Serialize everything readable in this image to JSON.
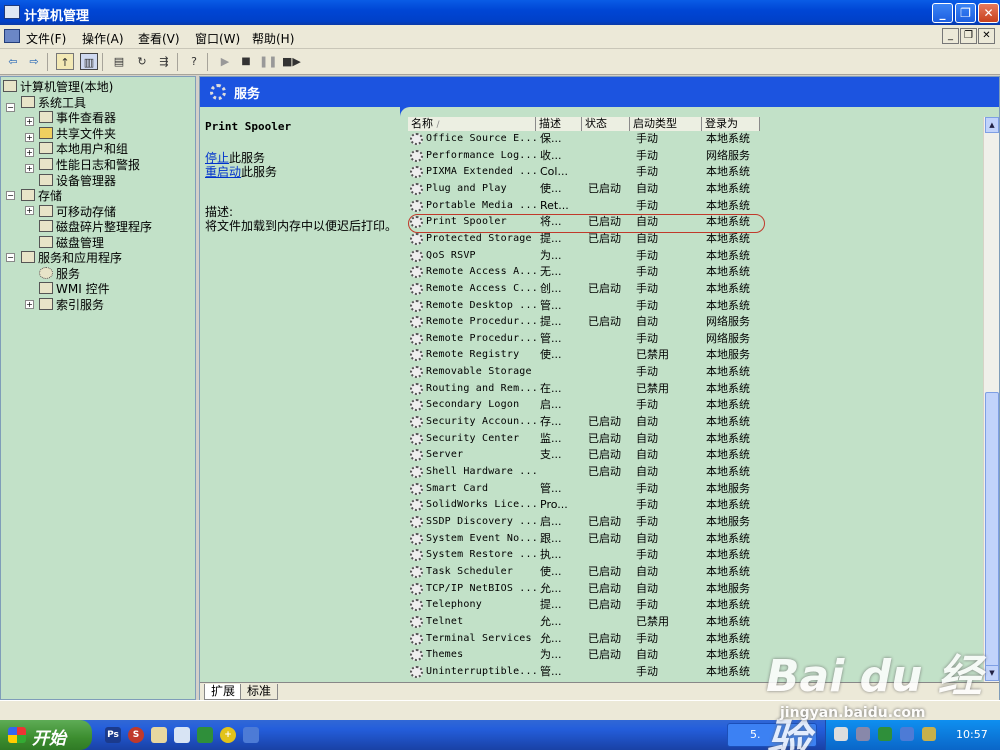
{
  "window": {
    "title": "计算机管理"
  },
  "menu": [
    "文件(F)",
    "操作(A)",
    "查看(V)",
    "窗口(W)",
    "帮助(H)"
  ],
  "tree": {
    "root": "计算机管理(本地)",
    "system_tools": "系统工具",
    "event_viewer": "事件查看器",
    "shared_folders": "共享文件夹",
    "local_users": "本地用户和组",
    "perf_logs": "性能日志和警报",
    "device_manager": "设备管理器",
    "storage": "存储",
    "removable_storage": "可移动存储",
    "defrag": "磁盘碎片整理程序",
    "disk_mgmt": "磁盘管理",
    "services_apps": "服务和应用程序",
    "services": "服务",
    "wmi": "WMI 控件",
    "indexing": "索引服务"
  },
  "header": {
    "title": "服务"
  },
  "desc": {
    "service_name": "Print Spooler",
    "stop_link": "停止",
    "stop_suffix": "此服务",
    "restart_link": "重启动",
    "restart_suffix": "此服务",
    "label": "描述:",
    "text": "将文件加载到内存中以便迟后打印。"
  },
  "columns": [
    "名称",
    "描述",
    "状态",
    "启动类型",
    "登录为"
  ],
  "rows": [
    [
      "Office Source E...",
      "保...",
      "",
      "手动",
      "本地系统"
    ],
    [
      "Performance Log...",
      "收...",
      "",
      "手动",
      "网络服务"
    ],
    [
      "PIXMA Extended ...",
      "Col...",
      "",
      "手动",
      "本地系统"
    ],
    [
      "Plug and Play",
      "使...",
      "已启动",
      "自动",
      "本地系统"
    ],
    [
      "Portable Media ...",
      "Ret...",
      "",
      "手动",
      "本地系统"
    ],
    [
      "Print Spooler",
      "将...",
      "已启动",
      "自动",
      "本地系统"
    ],
    [
      "Protected Storage",
      "提...",
      "已启动",
      "自动",
      "本地系统"
    ],
    [
      "QoS RSVP",
      "为...",
      "",
      "手动",
      "本地系统"
    ],
    [
      "Remote Access A...",
      "无...",
      "",
      "手动",
      "本地系统"
    ],
    [
      "Remote Access C...",
      "创...",
      "已启动",
      "手动",
      "本地系统"
    ],
    [
      "Remote Desktop ...",
      "管...",
      "",
      "手动",
      "本地系统"
    ],
    [
      "Remote Procedur...",
      "提...",
      "已启动",
      "自动",
      "网络服务"
    ],
    [
      "Remote Procedur...",
      "管...",
      "",
      "手动",
      "网络服务"
    ],
    [
      "Remote Registry",
      "使...",
      "",
      "已禁用",
      "本地服务"
    ],
    [
      "Removable Storage",
      "",
      "",
      "手动",
      "本地系统"
    ],
    [
      "Routing and Rem...",
      "在...",
      "",
      "已禁用",
      "本地系统"
    ],
    [
      "Secondary Logon",
      "启...",
      "",
      "手动",
      "本地系统"
    ],
    [
      "Security Accoun...",
      "存...",
      "已启动",
      "自动",
      "本地系统"
    ],
    [
      "Security Center",
      "监...",
      "已启动",
      "自动",
      "本地系统"
    ],
    [
      "Server",
      "支...",
      "已启动",
      "自动",
      "本地系统"
    ],
    [
      "Shell Hardware ...",
      "",
      "已启动",
      "自动",
      "本地系统"
    ],
    [
      "Smart Card",
      "管...",
      "",
      "手动",
      "本地服务"
    ],
    [
      "SolidWorks Lice...",
      "Pro...",
      "",
      "手动",
      "本地系统"
    ],
    [
      "SSDP Discovery ...",
      "启...",
      "已启动",
      "手动",
      "本地服务"
    ],
    [
      "System Event No...",
      "跟...",
      "已启动",
      "自动",
      "本地系统"
    ],
    [
      "System Restore ...",
      "执...",
      "",
      "手动",
      "本地系统"
    ],
    [
      "Task Scheduler",
      "使...",
      "已启动",
      "自动",
      "本地系统"
    ],
    [
      "TCP/IP NetBIOS ...",
      "允...",
      "已启动",
      "自动",
      "本地服务"
    ],
    [
      "Telephony",
      "提...",
      "已启动",
      "手动",
      "本地系统"
    ],
    [
      "Telnet",
      "允...",
      "",
      "已禁用",
      "本地系统"
    ],
    [
      "Terminal Services",
      "允...",
      "已启动",
      "手动",
      "本地系统"
    ],
    [
      "Themes",
      "为...",
      "已启动",
      "自动",
      "本地系统"
    ],
    [
      "Uninterruptible...",
      "管...",
      "",
      "手动",
      "本地系统"
    ]
  ],
  "tabs": [
    "扩展",
    "标准"
  ],
  "taskbar": {
    "start": "开始",
    "task_item": "5.",
    "clock": "10:57"
  },
  "watermark": {
    "brand": "Bai du 经验",
    "url": "jingyan.baidu.com"
  }
}
